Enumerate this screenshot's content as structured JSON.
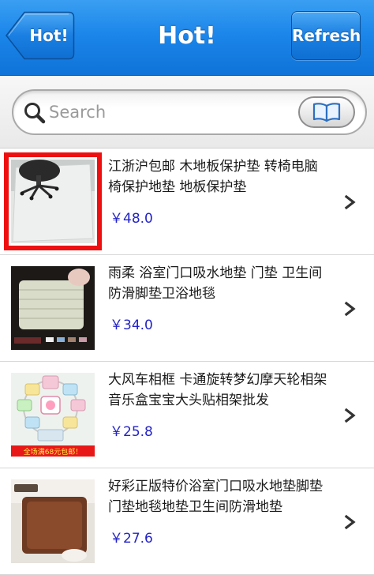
{
  "header": {
    "title": "Hot!",
    "back_label": "Hot!",
    "refresh_label": "Refresh",
    "bar_color": "#1c86ea"
  },
  "search": {
    "placeholder": "Search",
    "value": ""
  },
  "icons": {
    "search": "search-icon",
    "book": "book-icon",
    "chevron": "chevron-right-icon"
  },
  "accent": {
    "price_color": "#2323c8",
    "selection_color": "#ee1010"
  },
  "products": [
    {
      "title": "江浙沪包邮 木地板保护垫 转椅电脑椅保护地垫 地板保护垫",
      "price": "￥48.0",
      "selected": true
    },
    {
      "title": "雨柔 浴室门口吸水地垫 门垫 卫生间 防滑脚垫卫浴地毯",
      "price": "￥34.0",
      "selected": false
    },
    {
      "title": "大风车相框 卡通旋转梦幻摩天轮相架 音乐盒宝宝大头贴相架批发",
      "price": "￥25.8",
      "selected": false,
      "thumb_banner": "全场满68元包邮！"
    },
    {
      "title": "好彩正版特价浴室门口吸水地垫脚垫门垫地毯地垫卫生间防滑地垫",
      "price": "￥27.6",
      "selected": false
    }
  ]
}
